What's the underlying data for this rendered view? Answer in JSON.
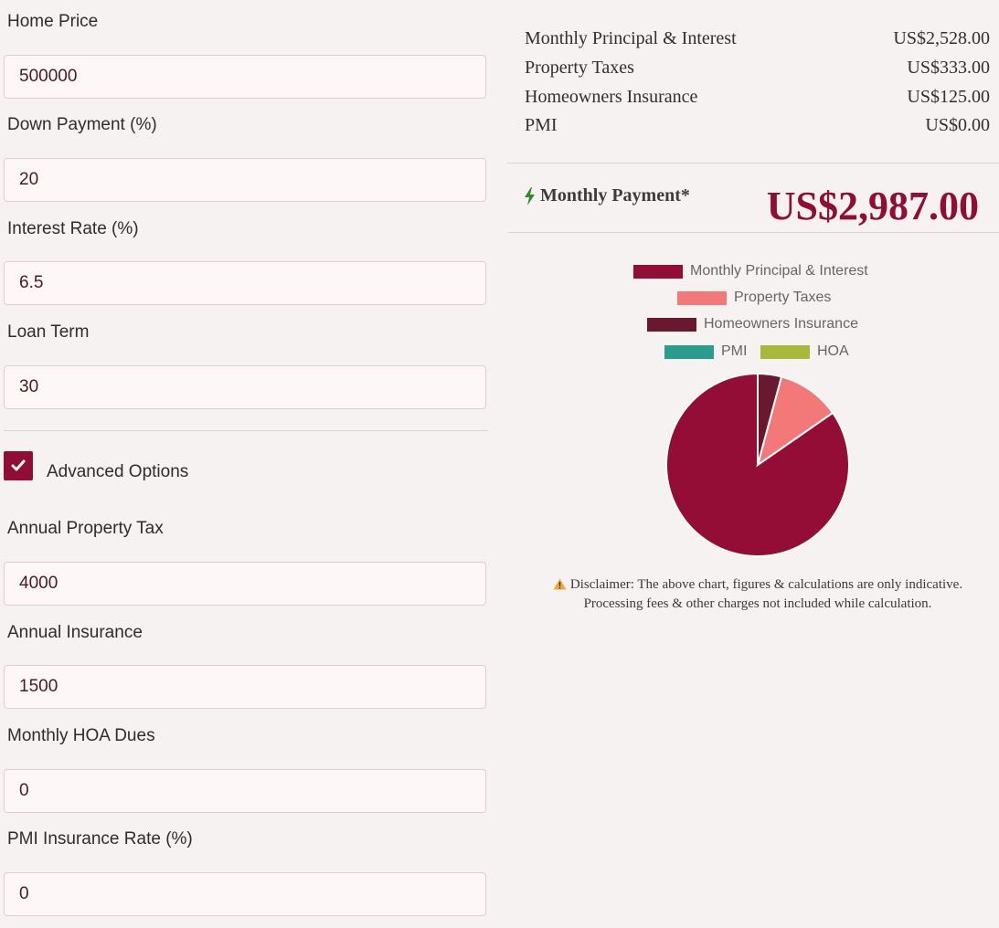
{
  "form": {
    "home_price": {
      "label": "Home Price",
      "value": "500000"
    },
    "down_payment": {
      "label": "Down Payment (%)",
      "value": "20"
    },
    "interest_rate": {
      "label": "Interest Rate (%)",
      "value": "6.5"
    },
    "loan_term": {
      "label": "Loan Term",
      "value": "30"
    },
    "advanced_options": {
      "label": "Advanced Options",
      "checked": true
    },
    "property_tax": {
      "label": "Annual Property Tax",
      "value": "4000"
    },
    "insurance": {
      "label": "Annual Insurance",
      "value": "1500"
    },
    "hoa": {
      "label": "Monthly HOA Dues",
      "value": "0"
    },
    "pmi_rate": {
      "label": "PMI Insurance Rate (%)",
      "value": "0"
    }
  },
  "summary": {
    "rows": [
      {
        "label": "Monthly Principal & Interest",
        "value": "US$2,528.00"
      },
      {
        "label": "Property Taxes",
        "value": "US$333.00"
      },
      {
        "label": "Homeowners Insurance",
        "value": "US$125.00"
      },
      {
        "label": "PMI",
        "value": "US$0.00"
      }
    ],
    "monthly_payment_label": "Monthly Payment*",
    "monthly_payment_value": "US$2,987.00",
    "bolt_icon": "lightning-bolt-icon",
    "bolt_color": "#2e8b2e"
  },
  "chart_data": {
    "type": "pie",
    "categories": [
      "Monthly Principal & Interest",
      "Property Taxes",
      "Homeowners Insurance",
      "PMI",
      "HOA"
    ],
    "values": [
      2528,
      333,
      125,
      0,
      0
    ],
    "colors": [
      "#930d37",
      "#f37878",
      "#6a1830",
      "#2a9d8f",
      "#a8b93a"
    ],
    "legend_position": "top"
  },
  "disclaimer": {
    "line1": "Disclaimer: The above chart, figures & calculations are only indicative.",
    "line2": "Processing fees & other charges not included while calculation.",
    "icon": "warning-icon"
  },
  "colors": {
    "accent": "#8f0d36",
    "background": "#f6f2f1"
  }
}
